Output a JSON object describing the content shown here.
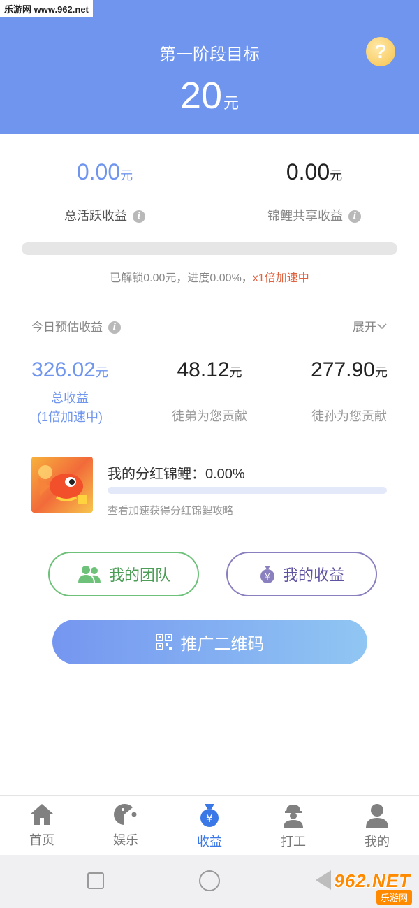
{
  "watermark": "乐游网 www.962.net",
  "header": {
    "title": "第一阶段目标",
    "target_value": "20",
    "target_unit": "元",
    "help_icon": "?"
  },
  "stats": {
    "active": {
      "value": "0.00",
      "unit": "元",
      "label": "总活跃收益",
      "color": "#6f95ee"
    },
    "koi_share": {
      "value": "0.00",
      "unit": "元",
      "label": "锦鲤共享收益"
    }
  },
  "progress": {
    "fraction": 0.0,
    "text_before": "已解锁0.00元，进度0.00%，",
    "text_accent": "x1倍加速中",
    "accent_color": "#e0623f"
  },
  "today": {
    "label": "今日预估收益",
    "expand": "展开",
    "total": {
      "value": "326.02",
      "unit": "元",
      "label1": "总收益",
      "label2": "(1倍加速中)"
    },
    "apprentice": {
      "value": "48.12",
      "unit": "元",
      "label": "徒弟为您贡献"
    },
    "grand_apprentice": {
      "value": "277.90",
      "unit": "元",
      "label": "徒孙为您贡献"
    }
  },
  "koi": {
    "title": "我的分红锦鲤：0.00%",
    "fraction": 0.0,
    "subtitle": "查看加速获得分红锦鲤攻略"
  },
  "buttons": {
    "team": "我的团队",
    "earnings": "我的收益",
    "promote": "推广二维码"
  },
  "tabs": [
    {
      "label": "首页",
      "icon": "home-icon"
    },
    {
      "label": "娱乐",
      "icon": "game-icon"
    },
    {
      "label": "收益",
      "icon": "money-bag-icon",
      "active": true
    },
    {
      "label": "打工",
      "icon": "worker-icon"
    },
    {
      "label": "我的",
      "icon": "user-icon"
    }
  ],
  "brand": {
    "main": "962.NET",
    "sub": "乐游网"
  },
  "colors": {
    "header": "#6f95ee",
    "active_tab": "#3b78e7",
    "team": "#6dc179",
    "earnings": "#8a7fbf"
  }
}
